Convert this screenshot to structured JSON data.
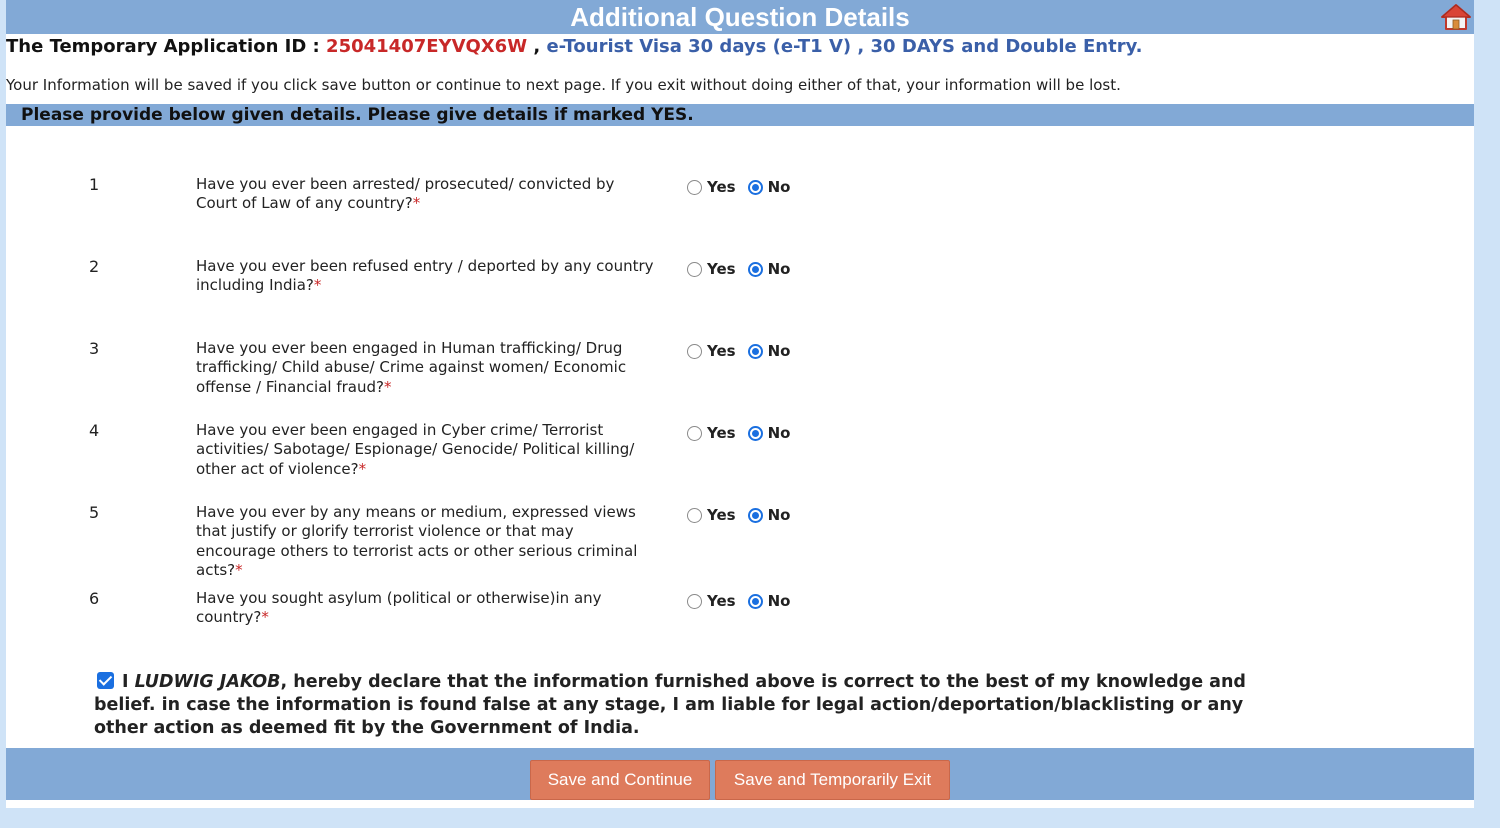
{
  "header": {
    "title": "Additional Question Details",
    "home_icon": "home-icon"
  },
  "application": {
    "id_label": "The Temporary Application ID :",
    "id_value": "25041407EYVQX6W",
    "sep1": ",",
    "visa_type": "e-Tourist Visa 30 days (e-T1 V)",
    "sep2": ",",
    "duration": "30 DAYS and Double Entry."
  },
  "info_text": "Your Information will be saved if you click save button or continue to next page. If you exit without doing either of that, your information will be lost.",
  "section_title": "Please provide below given details. Please give details if marked YES.",
  "required_mark": "*",
  "options": {
    "yes": "Yes",
    "no": "No"
  },
  "questions": [
    {
      "num": "1",
      "text": "Have you ever been arrested/ prosecuted/ convicted by Court of Law of any country?",
      "answer": "No"
    },
    {
      "num": "2",
      "text": "Have you ever been refused entry / deported by any country including India?",
      "answer": "No"
    },
    {
      "num": "3",
      "text": "Have you ever been engaged in Human trafficking/ Drug trafficking/ Child abuse/ Crime against women/ Economic offense / Financial fraud?",
      "answer": "No"
    },
    {
      "num": "4",
      "text": "Have you ever been engaged in Cyber crime/ Terrorist activities/ Sabotage/ Espionage/ Genocide/ Political killing/ other act of violence?",
      "answer": "No"
    },
    {
      "num": "5",
      "text": "Have you ever by any means or medium, expressed views that justify or glorify terrorist violence or that may encourage others to terrorist acts or other serious criminal acts?",
      "answer": "No"
    },
    {
      "num": "6",
      "text": "Have you sought asylum (political or otherwise)in any country?",
      "answer": "No"
    }
  ],
  "declaration": {
    "checked": true,
    "prefix": "I",
    "name": "LUDWIG JAKOB",
    "text": ", hereby declare that the information furnished above is correct to the best of my knowledge and belief. in case the information is found false at any stage, I am liable for legal action/deportation/blacklisting or any other action as deemed fit by the Government of India."
  },
  "buttons": {
    "save_continue": "Save and Continue",
    "save_exit": "Save and Temporarily Exit"
  },
  "colors": {
    "header_bar": "#82a9d6",
    "button": "#de7b5c",
    "id_red": "#c82828",
    "visa_blue": "#3a5fa8",
    "radio_blue": "#1a6fe0"
  }
}
